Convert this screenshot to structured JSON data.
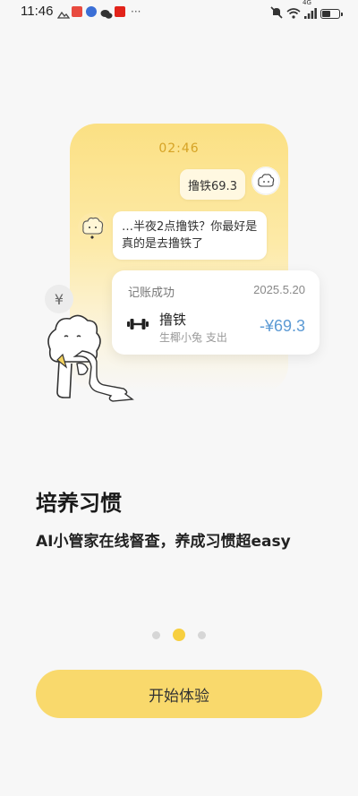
{
  "status_bar": {
    "time": "11:46",
    "notification_icons": [
      "photo-icon",
      "red-app-icon",
      "music-icon",
      "wechat-icon",
      "news-app-icon"
    ],
    "more": "···",
    "network": "4G",
    "battery_percent": 50
  },
  "illustration": {
    "phone_time": "02:46",
    "user_message": "撸铁69.3",
    "bot_message": "…半夜2点撸铁？你最好是真的是去撸铁了",
    "record": {
      "title": "记账成功",
      "date": "2025.5.20",
      "item_name": "撸铁",
      "item_sub": "生椰小兔 支出",
      "amount": "-¥69.3",
      "icon": "dumbbell-icon"
    },
    "yen_symbol": "¥"
  },
  "headline": "培养习惯",
  "subheadline": "AI小管家在线督查，养成习惯超easy",
  "pager": {
    "total": 3,
    "active_index": 1
  },
  "cta_label": "开始体验",
  "colors": {
    "accent": "#f9d96c",
    "amount": "#5c9ad4",
    "page_bg": "#f7f7f7"
  }
}
